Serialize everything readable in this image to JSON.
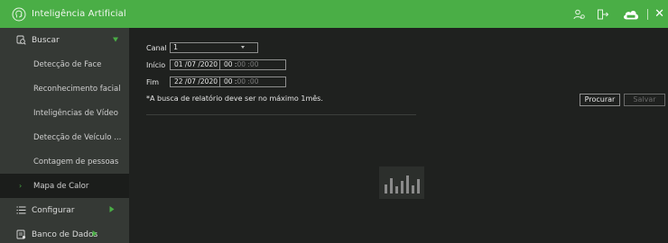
{
  "window": {
    "title": "Inteligência Artificial",
    "accent": "#4aae46"
  },
  "toolbar": {
    "icons": [
      "user-group-icon",
      "exit-icon",
      "cloud-icon",
      "close-icon"
    ],
    "close_glyph": "✕"
  },
  "sidebar": {
    "groups": [
      {
        "label": "Buscar",
        "icon": "search-icon",
        "expanded": true
      },
      {
        "label": "Configurar",
        "icon": "list-icon",
        "expanded": false
      },
      {
        "label": "Banco de Dados",
        "icon": "database-icon",
        "expanded": false
      }
    ],
    "items": [
      {
        "label": "Detecção de Face"
      },
      {
        "label": "Reconhecimento facial"
      },
      {
        "label": "Inteligências de Vídeo"
      },
      {
        "label": "Detecção de Veículo ..."
      },
      {
        "label": "Contagem de pessoas"
      },
      {
        "label": "Mapa de Calor",
        "selected": true
      }
    ],
    "bullet": "›"
  },
  "form": {
    "canal_label": "Canal",
    "canal_value": "1",
    "inicio_label": "Início",
    "inicio_date": "01 /07 /2020",
    "inicio_time_h": "00 :",
    "inicio_time_rest": "00 :00",
    "fim_label": "Fim",
    "fim_date": "22 /07 /2020",
    "fim_time_h": "00 :",
    "fim_time_rest": "00 :00",
    "note": "*A busca de relatório deve ser no máximo 1mês."
  },
  "actions": {
    "search_label": "Procurar",
    "save_label": "Salvar"
  }
}
